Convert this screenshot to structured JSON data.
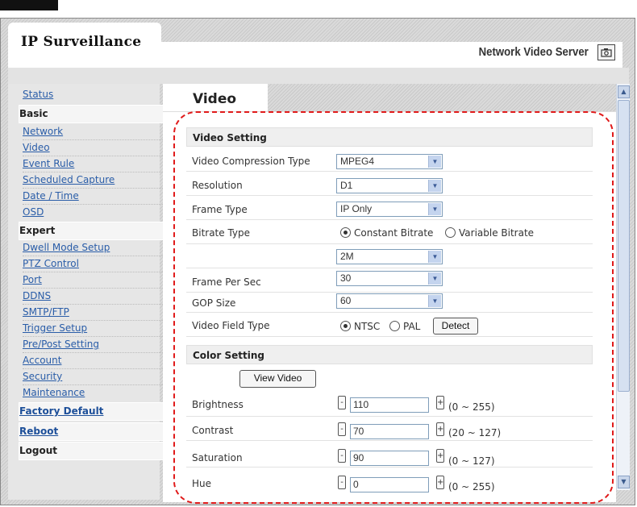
{
  "app": {
    "title": "IP Surveillance",
    "product": "Network Video Server",
    "camera_icon": "camera-icon"
  },
  "sidebar": {
    "status": "Status",
    "basic": "Basic",
    "basic_items": [
      "Network",
      "Video",
      "Event Rule",
      "Scheduled Capture",
      "Date / Time",
      "OSD"
    ],
    "expert": "Expert",
    "expert_items": [
      "Dwell Mode Setup",
      "PTZ Control",
      "Port",
      "DDNS",
      "SMTP/FTP",
      "Trigger Setup",
      "Pre/Post Setting",
      "Account",
      "Security",
      "Maintenance"
    ],
    "factory_default": "Factory Default",
    "reboot": "Reboot",
    "logout": "Logout"
  },
  "page": {
    "title": "Video"
  },
  "video_setting": {
    "header": "Video Setting",
    "compression_label": "Video Compression Type",
    "compression_value": "MPEG4",
    "resolution_label": "Resolution",
    "resolution_value": "D1",
    "frame_type_label": "Frame Type",
    "frame_type_value": "IP Only",
    "bitrate_type_label": "Bitrate Type",
    "bitrate_constant": "Constant Bitrate",
    "bitrate_variable": "Variable Bitrate",
    "bitrate_selected": "Constant Bitrate",
    "bitrate_value": "2M",
    "fps_label": "Frame Per Sec",
    "fps_value": "30",
    "gop_label": "GOP Size",
    "gop_value": "60",
    "field_type_label": "Video Field Type",
    "field_ntsc": "NTSC",
    "field_pal": "PAL",
    "field_selected": "NTSC",
    "detect_button": "Detect"
  },
  "color_setting": {
    "header": "Color Setting",
    "view_video_button": "View Video",
    "brightness_label": "Brightness",
    "brightness_value": "110",
    "brightness_range": "(0 ~ 255)",
    "contrast_label": "Contrast",
    "contrast_value": "70",
    "contrast_range": "(20 ~ 127)",
    "saturation_label": "Saturation",
    "saturation_value": "90",
    "saturation_range": "(0 ~ 127)",
    "hue_label": "Hue",
    "hue_value": "0",
    "hue_range": "(0 ~ 255)",
    "minus": "-",
    "plus": "+"
  },
  "colors": {
    "link": "#2a5da8",
    "annotation": "#e01a1a",
    "panel_bg": "#e6e6e6"
  }
}
